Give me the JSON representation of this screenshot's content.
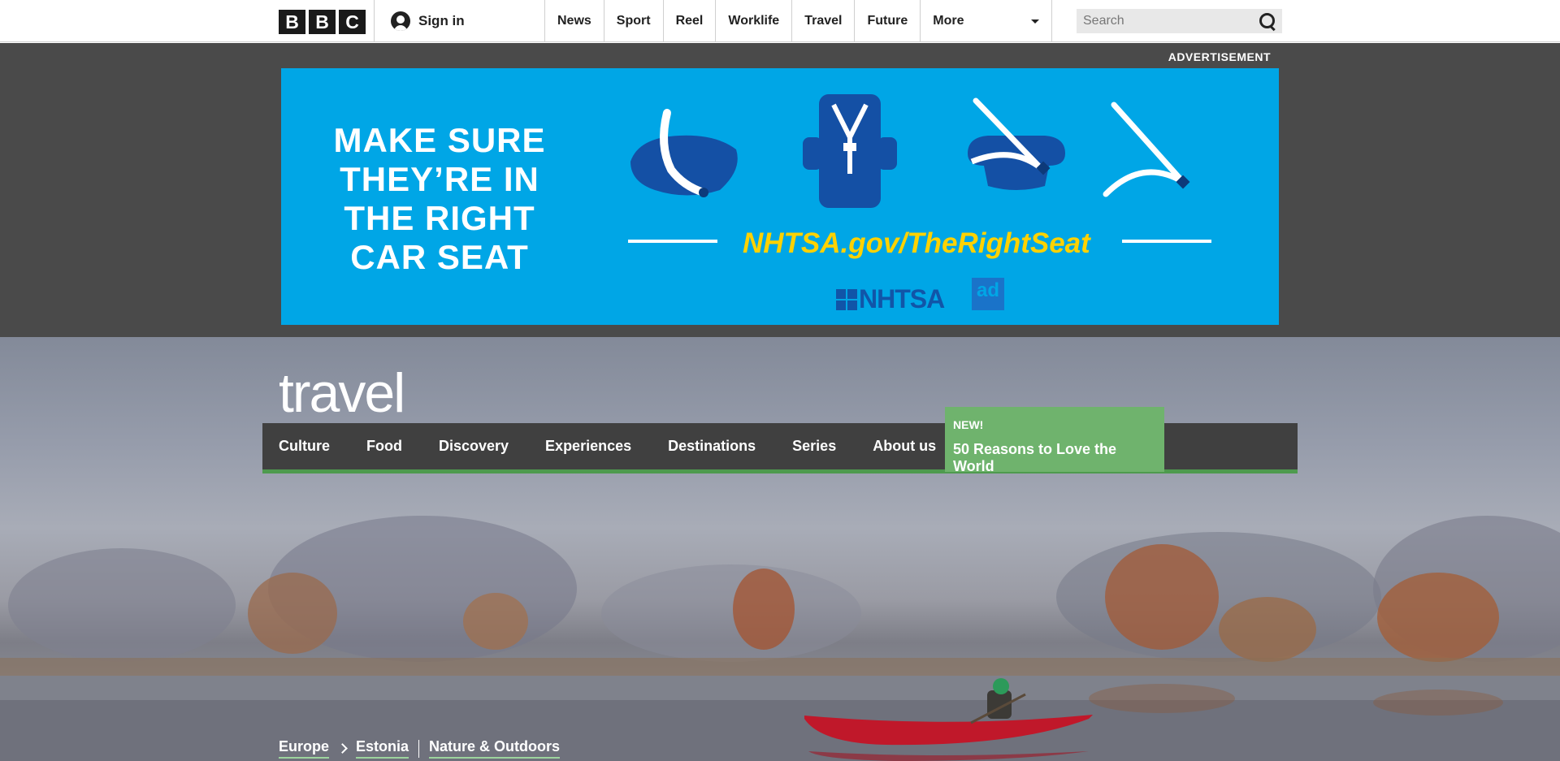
{
  "header": {
    "logo_letters": [
      "B",
      "B",
      "C"
    ],
    "signin_label": "Sign in",
    "nav": [
      "News",
      "Sport",
      "Reel",
      "Worklife",
      "Travel",
      "Future"
    ],
    "more_label": "More",
    "search_placeholder": "Search"
  },
  "ad": {
    "label": "ADVERTISEMENT",
    "headline": [
      "MAKE SURE",
      "THEY’RE IN",
      "THE RIGHT",
      "CAR SEAT"
    ],
    "url": "NHTSA.gov/TheRightSeat",
    "brand": "NHTSA",
    "council": "ad"
  },
  "travel": {
    "logo": "travel",
    "nav": [
      "Culture",
      "Food",
      "Discovery",
      "Experiences",
      "Destinations",
      "Series",
      "About us"
    ],
    "promo": {
      "badge": "NEW!",
      "title": "50 Reasons to Love the World"
    },
    "breadcrumb": [
      "Europe",
      "Estonia",
      "Nature & Outdoors"
    ]
  },
  "colors": {
    "ad_blue": "#00a6e6",
    "ad_yellow": "#ffd200",
    "nav_dark": "#404040",
    "promo_green": "#6fb36d",
    "canoe_red": "#c0182a"
  }
}
